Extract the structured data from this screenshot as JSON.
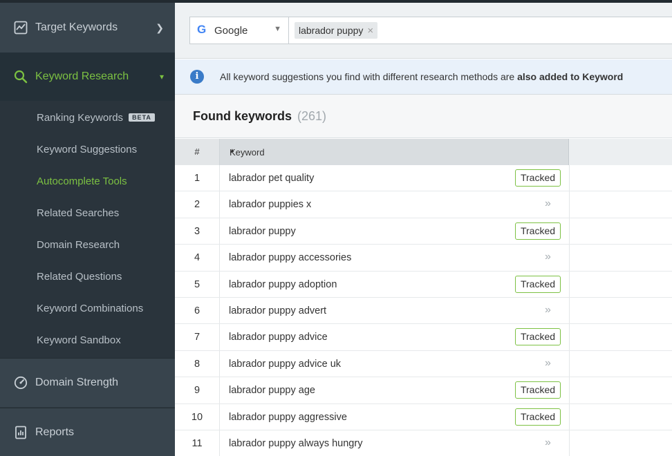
{
  "sidebar": {
    "target_keywords": "Target Keywords",
    "keyword_research": "Keyword Research",
    "sub_items": [
      "Ranking Keywords",
      "Keyword Suggestions",
      "Autocomplete Tools",
      "Related Searches",
      "Domain Research",
      "Related Questions",
      "Keyword Combinations",
      "Keyword Sandbox"
    ],
    "beta_badge": "BETA",
    "active_sub_item": "Autocomplete Tools",
    "domain_strength": "Domain Strength",
    "reports": "Reports"
  },
  "search": {
    "engine": "Google",
    "keyword_chip": "labrador puppy",
    "chip_remove": "×"
  },
  "info": {
    "icon": "i",
    "text_before": "All keyword suggestions you find with different research methods are ",
    "text_bold": "also added to Keyword"
  },
  "found": {
    "title": "Found keywords",
    "count": "(261)"
  },
  "table": {
    "col_num": "#",
    "col_keyword": "Keyword",
    "sort_icon": "▲",
    "tracked_label": "Tracked",
    "arrow_label": "»",
    "rows": [
      {
        "num": "1",
        "keyword": "labrador pet quality",
        "tracked": true
      },
      {
        "num": "2",
        "keyword": "labrador puppies x",
        "tracked": false
      },
      {
        "num": "3",
        "keyword": "labrador puppy",
        "tracked": true
      },
      {
        "num": "4",
        "keyword": "labrador puppy accessories",
        "tracked": false
      },
      {
        "num": "5",
        "keyword": "labrador puppy adoption",
        "tracked": true
      },
      {
        "num": "6",
        "keyword": "labrador puppy advert",
        "tracked": false
      },
      {
        "num": "7",
        "keyword": "labrador puppy advice",
        "tracked": true
      },
      {
        "num": "8",
        "keyword": "labrador puppy advice uk",
        "tracked": false
      },
      {
        "num": "9",
        "keyword": "labrador puppy age",
        "tracked": true
      },
      {
        "num": "10",
        "keyword": "labrador puppy aggressive",
        "tracked": true
      },
      {
        "num": "11",
        "keyword": "labrador puppy always hungry",
        "tracked": false
      }
    ]
  },
  "colors": {
    "sidebar_bg": "#2f3a42",
    "accent_green": "#7cc142",
    "info_blue": "#3a7bc8"
  }
}
